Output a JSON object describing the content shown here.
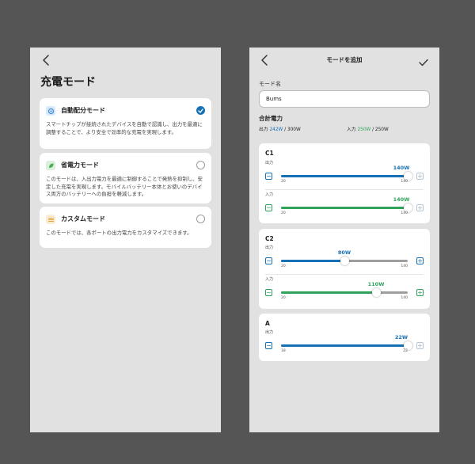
{
  "colors": {
    "background": "#555555",
    "screen": "#e1e1e1",
    "accent_blue": "#1670b5",
    "accent_green": "#2fa35a",
    "track_gray": "#9e9e9e"
  },
  "left": {
    "back_icon": "chevron-left-icon",
    "title": "充電モード",
    "modes": [
      {
        "icon": "auto-distribution-icon",
        "icon_color": "#3b8ad8",
        "name": "自動配分モード",
        "selected": true,
        "description": "スマートチップが接続されたデバイスを自動で認識し、出力を最適に調整することで、より安全で効率的な充電を実現します。"
      },
      {
        "icon": "leaf-icon",
        "icon_color": "#4caf50",
        "name": "省電力モード",
        "selected": false,
        "description": "このモードは、入出力電力を最適に制御することで発熱を抑制し、安定した充電を実現します。モバイルバッテリー本体とお使いのデバイス両方のバッテリーへの負担を軽減します。"
      },
      {
        "icon": "sliders-icon",
        "icon_color": "#e6a23c",
        "name": "カスタムモード",
        "selected": false,
        "description": "このモードでは、各ポートの出力電力をカスタマイズできます。"
      }
    ]
  },
  "right": {
    "title": "モードを追加",
    "confirm_icon": "checkmark-icon",
    "name_label": "モード名",
    "name_value": "Bums",
    "total_label": "合計電力",
    "output": {
      "label": "出力",
      "value": "242W",
      "max": " / 300W"
    },
    "input": {
      "label": "入力",
      "value": "250W",
      "max": " / 250W"
    },
    "ports": [
      {
        "name": "C1",
        "sliders": [
          {
            "label": "出力",
            "value": 140,
            "unit": "W",
            "min": 20,
            "max": 140,
            "color": "#1670b5"
          },
          {
            "label": "入力",
            "value": 140,
            "unit": "W",
            "min": 20,
            "max": 140,
            "color": "#2fa35a"
          }
        ]
      },
      {
        "name": "C2",
        "sliders": [
          {
            "label": "出力",
            "value": 80,
            "unit": "W",
            "min": 20,
            "max": 140,
            "color": "#1670b5"
          },
          {
            "label": "入力",
            "value": 110,
            "unit": "W",
            "min": 20,
            "max": 140,
            "color": "#2fa35a"
          }
        ]
      },
      {
        "name": "A",
        "sliders": [
          {
            "label": "出力",
            "value": 22,
            "unit": "W",
            "min": 18,
            "max": 22,
            "color": "#1670b5"
          }
        ]
      }
    ]
  }
}
